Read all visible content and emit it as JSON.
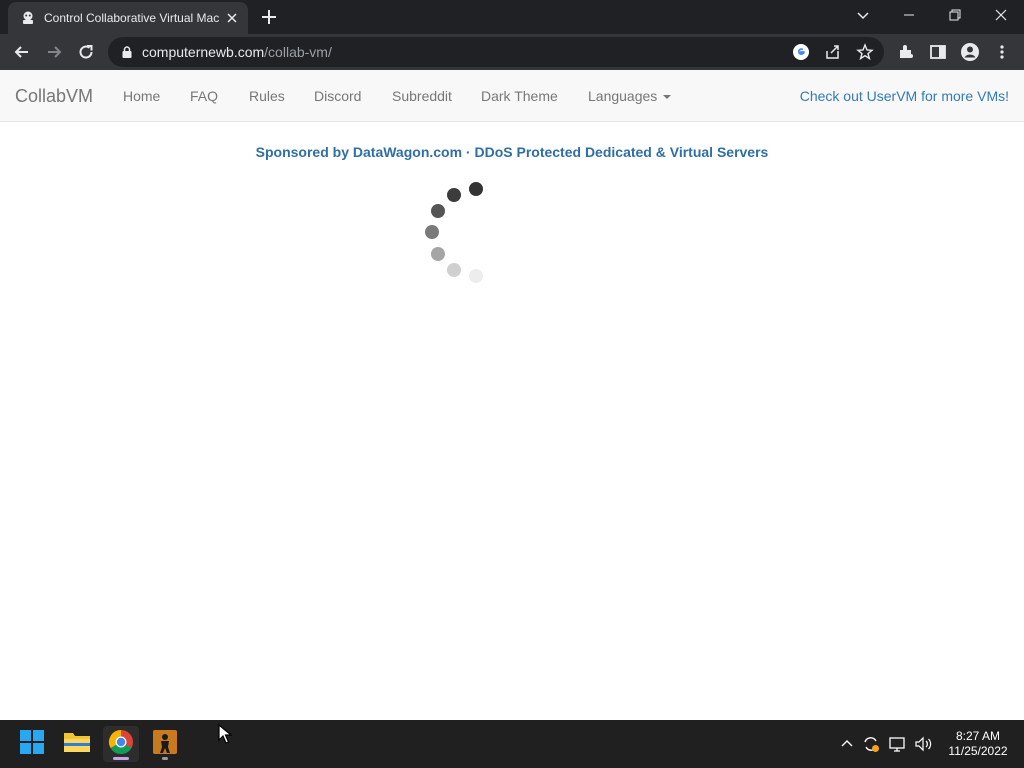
{
  "browser": {
    "tab": {
      "title": "Control Collaborative Virtual Machines",
      "favicon": "collabvm-favicon-icon"
    },
    "url": {
      "host": "computernewb.com",
      "path": "/collab-vm/"
    }
  },
  "page": {
    "brand": "CollabVM",
    "nav_links": [
      "Home",
      "FAQ",
      "Rules",
      "Discord",
      "Subreddit",
      "Dark Theme"
    ],
    "languages_label": "Languages",
    "promo_link": "Check out UserVM for more VMs!",
    "sponsor_text": "Sponsored by DataWagon.com · DDoS Protected Dedicated & Virtual Servers",
    "loading": true
  },
  "taskbar": {
    "apps": [
      "start-icon",
      "file-explorer-icon",
      "chrome-icon",
      "game-icon"
    ],
    "clock": {
      "time": "8:27 AM",
      "date": "11/25/2022"
    }
  },
  "colors": {
    "chrome_dark": "#202124",
    "chrome_tab": "#35363a",
    "navbar_bg": "#f8f8f8",
    "link_blue": "#337ab7",
    "taskbar_bg": "#202020"
  }
}
